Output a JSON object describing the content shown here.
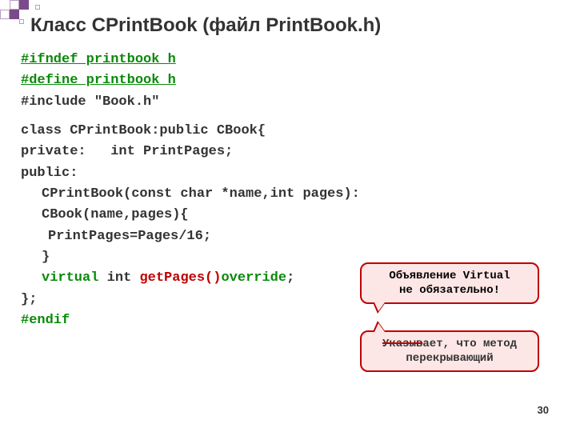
{
  "title": "Класс CPrintBook (файл PrintBook.h)",
  "code": {
    "l1": "#ifndef printbook_h",
    "l2": "#define printbook_h",
    "l3_a": "#include ",
    "l3_b": "\"Book.h\"",
    "l4": "class CPrintBook:public CBook{",
    "l5": "private:   int PrintPages;",
    "l6": "public:",
    "l7a": "CPrintBook(const char *name,int pages): CBook(name,pages){",
    "l8": "PrintPages=Pages/16;",
    "l9": "}",
    "l10_a": "virtual",
    "l10_b": " int ",
    "l10_c": "getPages()",
    "l10_d": "override",
    "l10_e": ";",
    "l11": "};",
    "l12": "#endif"
  },
  "callout1": {
    "line1": "Объявление Virtual",
    "line2": "не обязательно!"
  },
  "callout2": {
    "strike": "Указыв",
    "rest1": "ает, что метод",
    "line2": "перекрывающий"
  },
  "pagenum": "30"
}
